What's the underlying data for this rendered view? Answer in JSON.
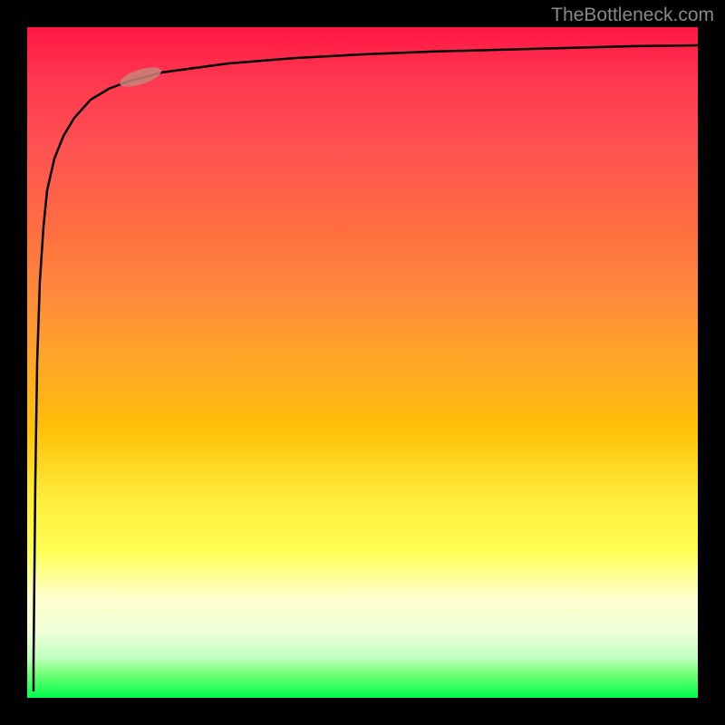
{
  "watermark": "TheBottleneck.com",
  "chart_data": {
    "type": "line",
    "title": "",
    "xlabel": "",
    "ylabel": "",
    "xlim": [
      0,
      100
    ],
    "ylim": [
      0,
      100
    ],
    "series": [
      {
        "name": "curve",
        "x": [
          1,
          1.5,
          2,
          2.5,
          3,
          4,
          5,
          7,
          10,
          15,
          20,
          30,
          40,
          50,
          60,
          70,
          80,
          90,
          100
        ],
        "y": [
          1,
          30,
          50,
          62,
          70,
          78,
          82,
          86,
          89,
          91,
          92.5,
          94,
          94.8,
          95.4,
          95.9,
          96.3,
          96.6,
          96.9,
          97.2
        ]
      }
    ],
    "marker": {
      "x": 15,
      "y": 91,
      "color": "#c8857a"
    },
    "background_gradient": {
      "top": "#ff1744",
      "bottom": "#00ff50"
    }
  }
}
